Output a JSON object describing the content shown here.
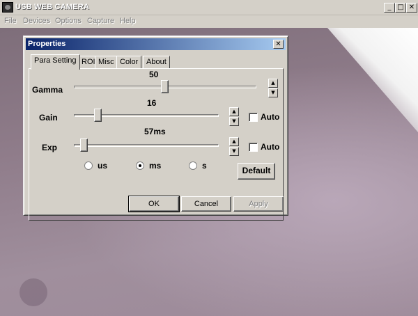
{
  "window": {
    "title": "USB WEB CAMERA",
    "buttons": {
      "minimize": "_",
      "maximize": "□",
      "close": "✕"
    }
  },
  "menu": [
    "File",
    "Devices",
    "Options",
    "Capture",
    "Help"
  ],
  "dialog": {
    "title": "Properties",
    "close": "✕",
    "tabs": [
      "Para Setting",
      "ROI",
      "Misc",
      "Color",
      "About"
    ],
    "active_tab": "Para Setting",
    "gamma": {
      "label": "Gamma",
      "value": "50",
      "level": 0.5
    },
    "gain": {
      "label": "Gain",
      "value": "16",
      "level": 0.16,
      "auto_label": "Auto",
      "auto": false
    },
    "exposure": {
      "label": "Exp",
      "value": "57ms",
      "level": 0.04,
      "auto_label": "Auto",
      "auto": false
    },
    "units": [
      {
        "label": "us",
        "selected": false
      },
      {
        "label": "ms",
        "selected": true
      },
      {
        "label": "s",
        "selected": false
      }
    ],
    "default_button": "Default",
    "ok": "OK",
    "cancel": "Cancel",
    "apply": "Apply"
  },
  "icons": {
    "spin_up": "▲",
    "spin_down": "▼"
  }
}
